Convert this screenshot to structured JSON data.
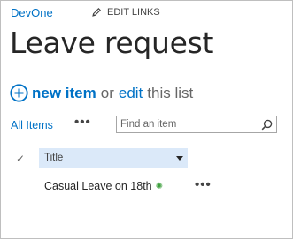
{
  "header": {
    "site_name": "DevOne",
    "edit_links_label": "EDIT LINKS"
  },
  "page": {
    "title": "Leave request"
  },
  "commands": {
    "new_item_label": "new item",
    "or_text": "or",
    "edit_label": "edit",
    "this_list_text": "this list"
  },
  "views": {
    "current_view": "All Items",
    "more_label": "•••"
  },
  "search": {
    "placeholder": "Find an item",
    "value": ""
  },
  "list": {
    "columns": [
      {
        "label": "Title"
      }
    ],
    "rows": [
      {
        "title": "Casual Leave on 18th",
        "new_badge": "✺",
        "menu_label": "•••"
      }
    ]
  },
  "colors": {
    "link": "#0072c6",
    "header_bg": "#dbe9f9",
    "new_badge": "#3ea03e"
  }
}
